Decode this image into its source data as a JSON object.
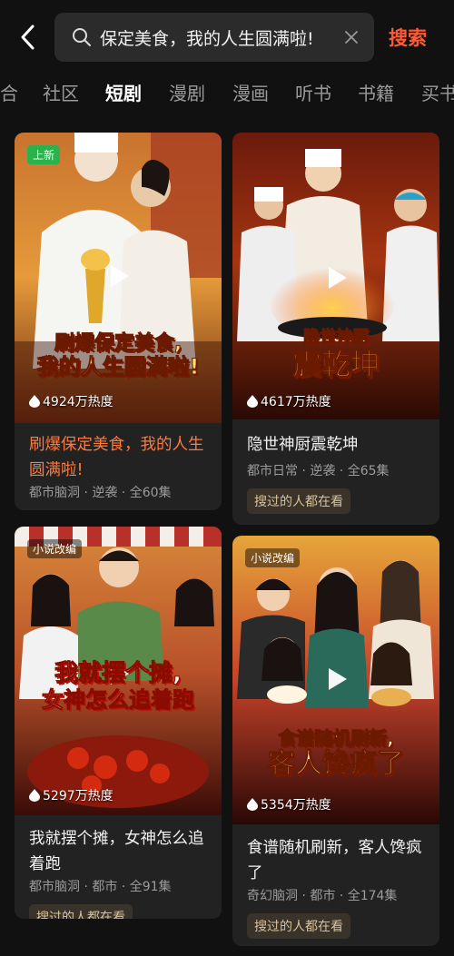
{
  "search": {
    "query": "保定美食，我的人生圆满啦!",
    "button_label": "搜索"
  },
  "tabs": [
    "合",
    "社区",
    "短剧",
    "漫剧",
    "漫画",
    "听书",
    "书籍",
    "买书"
  ],
  "active_tab": "短剧",
  "cards": [
    {
      "badge": "上新",
      "poster_title_line1": "刷爆保定美食,",
      "poster_title_line2": "我的人生圆满啦!",
      "heat": "4924万热度",
      "title": "刷爆保定美食，我的人生圆满啦!",
      "meta": "都市脑洞 · 逆袭 · 全60集",
      "tag": ""
    },
    {
      "badge": "",
      "poster_title_line1": "隐世神厨",
      "poster_title_line2": "震乾坤",
      "heat": "4617万热度",
      "title": "隐世神厨震乾坤",
      "meta": "都市日常 · 逆袭 · 全65集",
      "tag": "搜过的人都在看"
    },
    {
      "badge": "小说改编",
      "poster_title_line1": "我就摆个摊,",
      "poster_title_line2": "女神怎么追着跑",
      "heat": "5297万热度",
      "title": "我就摆个摊，女神怎么追着跑",
      "meta": "都市脑洞 · 都市 · 全91集",
      "tag": "搜过的人都在看"
    },
    {
      "badge": "小说改编",
      "poster_title_line1": "食谱随机刷新,",
      "poster_title_line2": "客人馋疯了",
      "heat": "5354万热度",
      "title": "食谱随机刷新，客人馋疯了",
      "meta": "奇幻脑洞 · 都市 · 全174集",
      "tag": "搜过的人都在看"
    }
  ],
  "colors": {
    "accent": "#ff5a36",
    "highlight_title": "#ff7a3c",
    "new_badge": "#2bb24c"
  },
  "icons": [
    "back-arrow-icon",
    "search-icon",
    "clear-icon",
    "play-icon",
    "flame-icon"
  ]
}
